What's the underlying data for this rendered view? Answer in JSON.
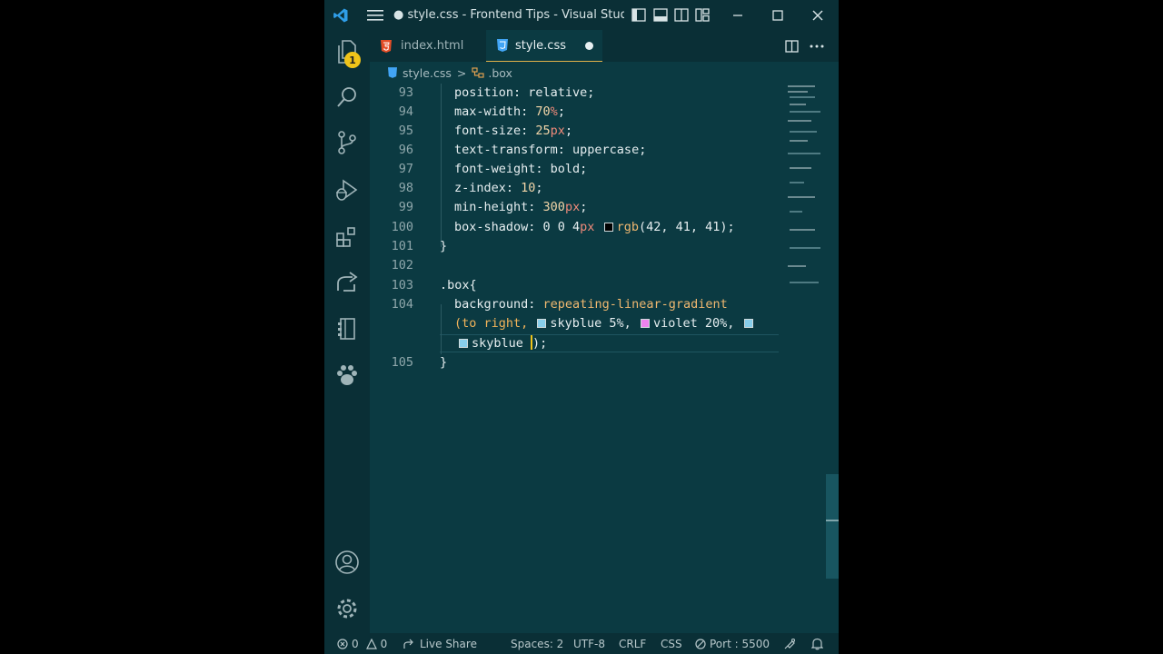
{
  "titlebar": {
    "title": "● style.css - Frontend Tips - Visual Studio C..."
  },
  "activity": {
    "explorer_badge": "1"
  },
  "tabs": [
    {
      "label": "index.html",
      "icon": "html5-icon"
    },
    {
      "label": "style.css",
      "icon": "css3-icon",
      "dirty": true
    }
  ],
  "breadcrumb": {
    "file": "style.css",
    "separator": ">",
    "symbol": ".box"
  },
  "editor": {
    "lines": [
      {
        "num": "93",
        "indent": 1,
        "text": "position: relative;"
      },
      {
        "num": "94",
        "indent": 1,
        "prop": "max-width: ",
        "num_val": "70",
        "unit": "%",
        "end": ";"
      },
      {
        "num": "95",
        "indent": 1,
        "prop": "font-size: ",
        "num_val": "25",
        "unit": "px",
        "end": ";"
      },
      {
        "num": "96",
        "indent": 1,
        "text": "text-transform: uppercase;"
      },
      {
        "num": "97",
        "indent": 1,
        "text": "font-weight: bold;"
      },
      {
        "num": "98",
        "indent": 1,
        "prop": "z-index: ",
        "num_val": "10",
        "unit": "",
        "end": ";"
      },
      {
        "num": "99",
        "indent": 1,
        "prop": "min-height: ",
        "num_val": "300",
        "unit": "px",
        "end": ";"
      },
      {
        "num": "100",
        "indent": 1,
        "prop": "box-shadow: 0 0 4",
        "unit": "px",
        "fn": "rgb",
        "args": "(42, 41, 41)",
        "end": ";"
      },
      {
        "num": "101",
        "text": "}"
      },
      {
        "num": "102",
        "text": ""
      },
      {
        "num": "103",
        "text": ".box{"
      },
      {
        "num": "104",
        "prop": "background: ",
        "fn": "repeating-linear-gradient"
      },
      {
        "wrap1": "(to right, ",
        "c1": "skyblue 5%, ",
        "c2": "violet 20%, "
      },
      {
        "wrap2": "skyblue ",
        "end": ");"
      },
      {
        "num": "105",
        "text": "}"
      }
    ],
    "colors": {
      "black": "#000000",
      "skyblue": "#87ceeb",
      "violet": "#ee82ee"
    }
  },
  "status": {
    "errors": "0",
    "warnings": "0",
    "live_share": "Live Share",
    "spaces": "Spaces: 2",
    "encoding": "UTF-8",
    "eol": "CRLF",
    "language": "CSS",
    "port": "Port : 5500"
  }
}
